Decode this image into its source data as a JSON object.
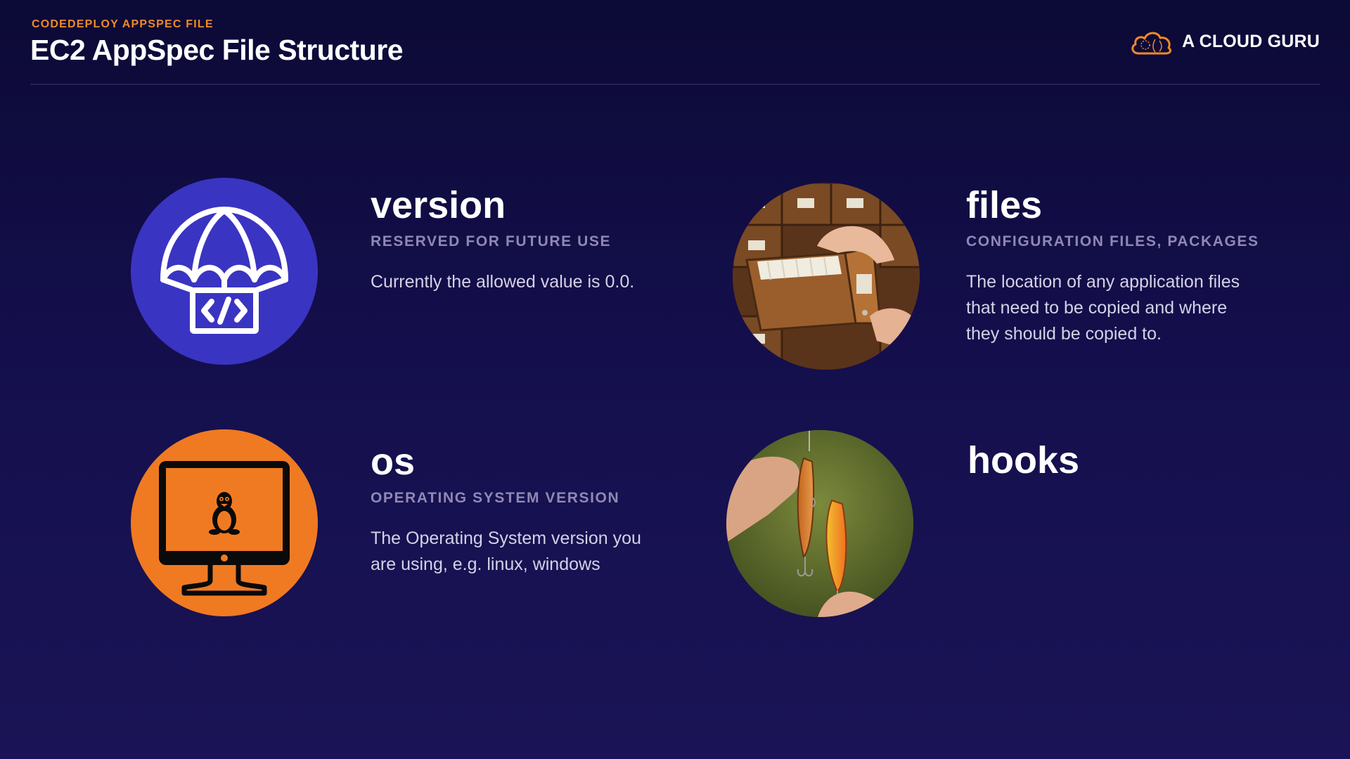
{
  "header": {
    "eyebrow": "CODEDEPLOY APPSPEC FILE",
    "title": "EC2 AppSpec File Structure",
    "brand": "A CLOUD GURU"
  },
  "colors": {
    "accent_orange": "#f08a26",
    "version_circle": "#3a34c2",
    "os_circle": "#f07a22"
  },
  "cards": {
    "version": {
      "icon": "parachute-code-icon",
      "heading": "version",
      "subheading": "RESERVED FOR FUTURE USE",
      "description": "Currently the allowed value is 0.0."
    },
    "files": {
      "icon": "card-catalog-drawer-photo",
      "heading": "files",
      "subheading": "CONFIGURATION FILES, PACKAGES",
      "description": "The location of any application files that need to be copied and where they should be copied to."
    },
    "os": {
      "icon": "monitor-linux-penguin-icon",
      "heading": "os",
      "subheading": "OPERATING SYSTEM VERSION",
      "description": "The Operating System version you are using, e.g. linux, windows"
    },
    "hooks": {
      "icon": "fishing-lure-hooks-photo",
      "heading": "hooks"
    }
  }
}
